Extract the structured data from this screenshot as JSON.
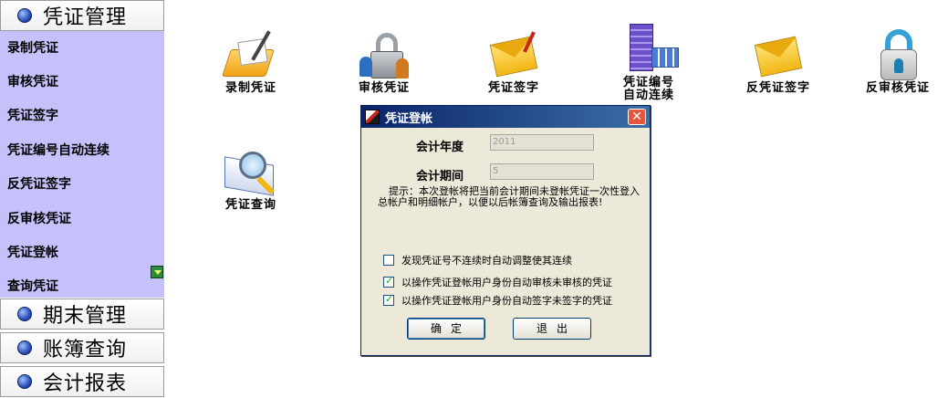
{
  "sidebar": {
    "sections": [
      {
        "label": "凭证管理"
      },
      {
        "label": "期末管理"
      },
      {
        "label": "账簿查询"
      },
      {
        "label": "会计报表"
      }
    ],
    "items": [
      {
        "label": "录制凭证"
      },
      {
        "label": "审核凭证"
      },
      {
        "label": "凭证签字"
      },
      {
        "label": "凭证编号自动连续"
      },
      {
        "label": "反凭证签字"
      },
      {
        "label": "反审核凭证"
      },
      {
        "label": "凭证登帐"
      },
      {
        "label": "查询凭证"
      }
    ]
  },
  "desktop": {
    "tiles": [
      {
        "label": "录制凭证",
        "icon": "folder-pen-icon"
      },
      {
        "label": "审核凭证",
        "icon": "lock-users-icon"
      },
      {
        "label": "凭证签字",
        "icon": "envelope-sign-icon"
      },
      {
        "label": "凭证编号\n自动连续",
        "icon": "server-numbering-icon"
      },
      {
        "label": "反凭证签字",
        "icon": "envelope-icon"
      },
      {
        "label": "反审核凭证",
        "icon": "unlock-icon"
      },
      {
        "label": "凭证查询",
        "icon": "book-magnifier-icon"
      }
    ]
  },
  "dialog": {
    "title": "凭证登帐",
    "close_label": "✕",
    "year_label": "会计年度",
    "year_value": "2011",
    "period_label": "会计期间",
    "period_value": "5",
    "hint": "提示：本次登帐将把当前会计期间未登帐凭证一次性登入总帐户和明细帐户，以便以后帐簿查询及输出报表!",
    "options": [
      {
        "label": "发现凭证号不连续时自动调整使其连续",
        "checked": false
      },
      {
        "label": "以操作凭证登帐用户身份自动审核未审核的凭证",
        "checked": true
      },
      {
        "label": "以操作凭证登帐用户身份自动签字未签字的凭证",
        "checked": true
      }
    ],
    "ok_label": "确定",
    "exit_label": "退出"
  },
  "colors": {
    "nav_background": "#c4c1fb",
    "titlebar": "#0a246a",
    "dialog_background": "#ece9d8"
  }
}
